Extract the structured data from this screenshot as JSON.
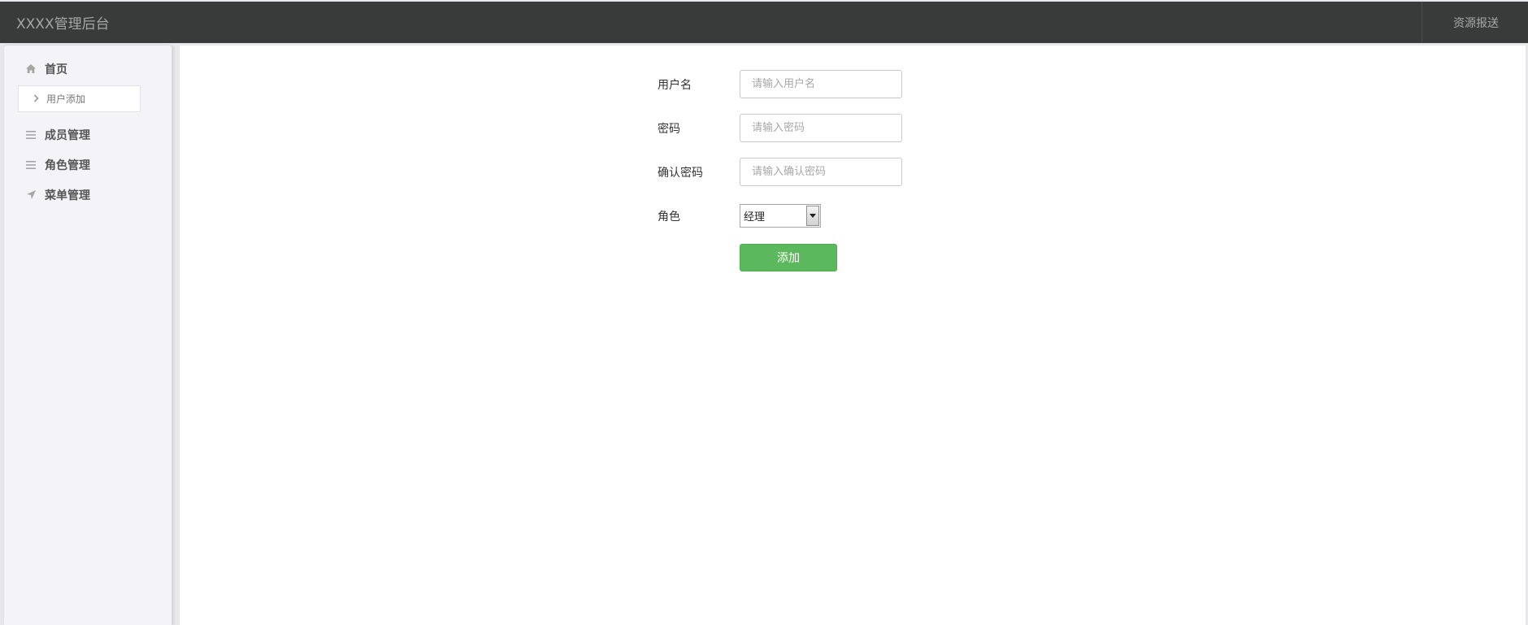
{
  "header": {
    "title": "XXXX管理后台",
    "right_link": "资源报送"
  },
  "sidebar": {
    "items": [
      {
        "label": "首页",
        "icon": "home-icon"
      },
      {
        "label": "成员管理",
        "icon": "list-icon"
      },
      {
        "label": "角色管理",
        "icon": "list-icon"
      },
      {
        "label": "菜单管理",
        "icon": "location-arrow-icon"
      }
    ],
    "subitems": [
      {
        "label": "用户添加",
        "icon": "chevron-right-icon"
      }
    ]
  },
  "form": {
    "username": {
      "label": "用户名",
      "placeholder": "请输入用户名",
      "value": ""
    },
    "password": {
      "label": "密码",
      "placeholder": "请输入密码",
      "value": ""
    },
    "confirm": {
      "label": "确认密码",
      "placeholder": "请输入确认密码",
      "value": ""
    },
    "role": {
      "label": "角色",
      "selected": "经理"
    },
    "submit_label": "添加"
  },
  "colors": {
    "topbar": "#383b3a",
    "sidebar": "#f4f4f8",
    "primary_button": "#5cb85c"
  }
}
